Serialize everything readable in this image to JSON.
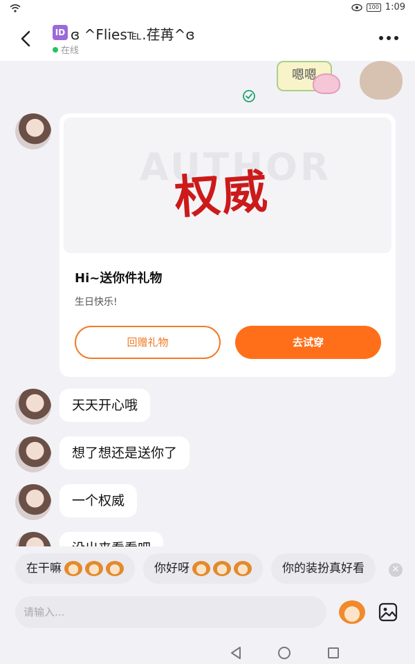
{
  "status_bar": {
    "time": "1:09",
    "battery": "100"
  },
  "header": {
    "id_badge": "ID",
    "title": "ɞ ^Flies℡.荏苒^ɞ",
    "online_status": "在线"
  },
  "sent_sticker": {
    "text": "嗯嗯"
  },
  "gift_card": {
    "image_title": "权威",
    "image_bg_text": "AUTHOR",
    "title": "Hi~送你件礼物",
    "subtitle": "生日快乐!",
    "return_button": "回赠礼物",
    "try_button": "去试穿"
  },
  "messages": [
    {
      "text": "天天开心哦"
    },
    {
      "text": "想了想还是送你了"
    },
    {
      "text": "一个权威"
    },
    {
      "text": "没出来看看吧"
    }
  ],
  "quick_replies": [
    {
      "label": "在干嘛"
    },
    {
      "label": "你好呀"
    },
    {
      "label": "你的装扮真好看"
    }
  ],
  "input": {
    "placeholder": "请输入..."
  },
  "colors": {
    "accent": "#ff6f1a",
    "online": "#22c55e",
    "title_red": "#cc1a1a"
  }
}
